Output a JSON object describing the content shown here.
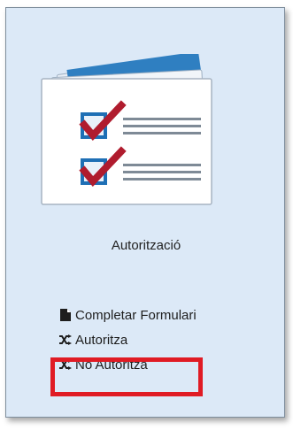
{
  "card": {
    "title": "Autorització"
  },
  "actions": [
    {
      "label": "Completar Formulari",
      "icon": "document-icon"
    },
    {
      "label": "Autoritza",
      "icon": "shuffle-icon"
    },
    {
      "label": "No Autoritza",
      "icon": "shuffle-icon"
    }
  ],
  "colors": {
    "card_background": "#dce9f7",
    "highlight": "#e01b24",
    "check_mark": "#b01c2e",
    "checkbox_border": "#1e6fb5"
  }
}
